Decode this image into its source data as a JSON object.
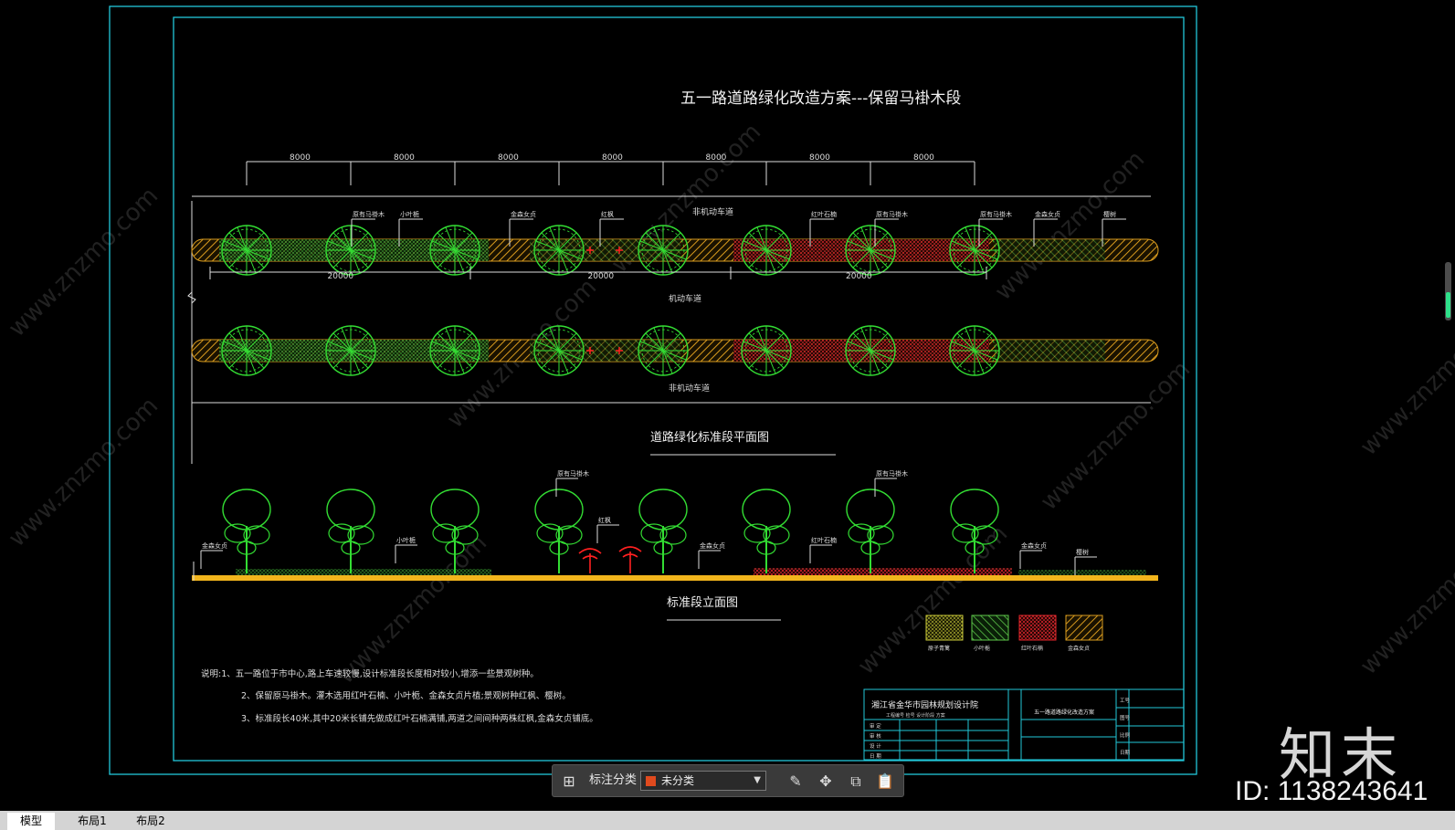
{
  "drawing": {
    "title": "五一路道路绿化改造方案---保留马褂木段",
    "dimensions_top": [
      "8000",
      "8000",
      "8000",
      "8000",
      "8000",
      "8000",
      "8000"
    ],
    "dimensions_bottom": [
      "20000",
      "20000",
      "20000"
    ],
    "road_labels": {
      "upper_lane": "非机动车道",
      "middle_lane": "机动车道",
      "lower_lane": "非机动车道"
    },
    "plan_labels": [
      "原有马褂木",
      "小叶栀",
      "金森女贞",
      "红枫",
      "红叶石楠",
      "原有马褂木",
      "原有马褂木",
      "金森女贞",
      "樱树"
    ],
    "plan_title": "道路绿化标准段平面图",
    "elevation_labels": [
      "金森女贞",
      "小叶栀",
      "原有马褂木",
      "红枫",
      "金森女贞",
      "红叶石楠",
      "原有马褂木",
      "金森女贞",
      "樱树"
    ],
    "elevation_title": "标准段立面图",
    "legend": [
      {
        "label": "原子青篱",
        "color": "#c9c93a"
      },
      {
        "label": "小叶栀",
        "color": "#5ec84a"
      },
      {
        "label": "红叶石楠",
        "color": "#e0252a"
      },
      {
        "label": "金森女贞",
        "color": "#d99b1e"
      }
    ],
    "notes": [
      "说明:1、五一路位于市中心,路上车速较慢,设计标准段长度相对较小,增添一些景观树种。",
      "2、保留原马褂木。灌木选用红叶石楠、小叶栀、金森女贞片植;景观树种红枫、樱树。",
      "3、标准段长40米,其中20米长铺先做成红叶石楠满铺,两道之间间种两株红枫,金森女贞铺底。"
    ],
    "title_block": {
      "company": "湘江省金华市园林规划设计院",
      "sub": "工程编号 检号 设计阶段 方案",
      "drawing_name": "五一路道路绿化改造方案",
      "rows": [
        "审 定",
        "审 核",
        "设 计",
        "日 期"
      ],
      "right_labels": [
        "工号",
        "图号",
        "比例",
        "日期"
      ]
    }
  },
  "toolbar": {
    "label": "标注分类",
    "selected": "未分类",
    "swatch_color": "#e04a1e",
    "icons": [
      "grid-icon",
      "edit-icon",
      "move-icon",
      "copy-icon",
      "paste-icon"
    ]
  },
  "tabs": [
    "模型",
    "布局1",
    "布局2"
  ],
  "watermark": {
    "logo": "知末",
    "id": "ID: 1138243641"
  }
}
